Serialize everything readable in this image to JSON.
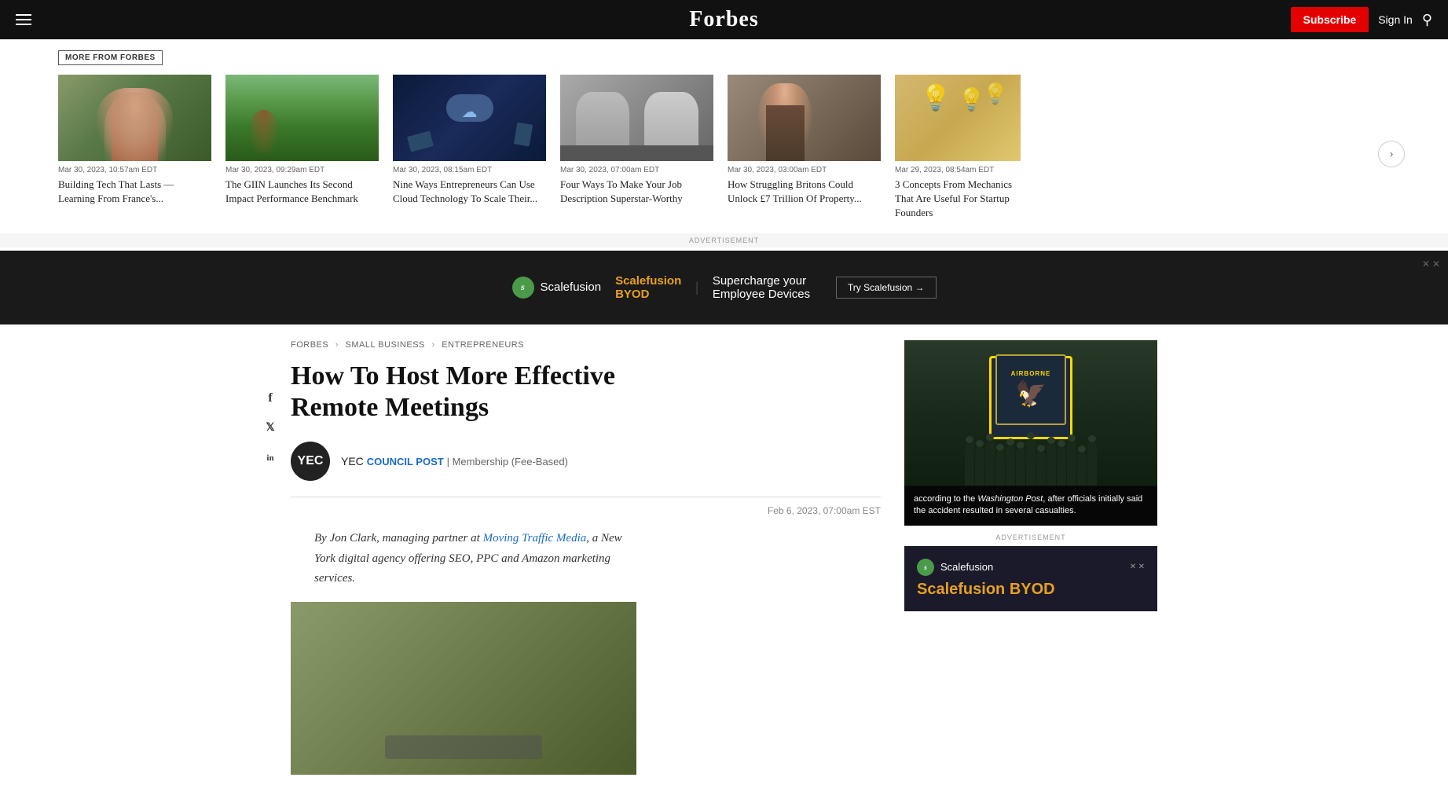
{
  "header": {
    "logo": "Forbes",
    "subscribe_label": "Subscribe",
    "sign_in_label": "Sign In"
  },
  "more_from_forbes": {
    "badge_label": "MORE FROM FORBES",
    "cards": [
      {
        "id": "card-1",
        "date": "Mar 30, 2023, 10:57am EDT",
        "title": "Building Tech That Lasts — Learning From France's...",
        "img_type": "person"
      },
      {
        "id": "card-2",
        "date": "Mar 30, 2023, 09:29am EDT",
        "title": "The GIIN Launches Its Second Impact Performance Benchmark",
        "img_type": "farm"
      },
      {
        "id": "card-3",
        "date": "Mar 30, 2023, 08:15am EDT",
        "title": "Nine Ways Entrepreneurs Can Use Cloud Technology To Scale Their...",
        "img_type": "cloud"
      },
      {
        "id": "card-4",
        "date": "Mar 30, 2023, 07:00am EDT",
        "title": "Four Ways To Make Your Job Description Superstar-Worthy",
        "img_type": "handshake"
      },
      {
        "id": "card-5",
        "date": "Mar 30, 2023, 03:00am EDT",
        "title": "How Struggling Britons Could Unlock £7 Trillion Of Property...",
        "img_type": "person2"
      },
      {
        "id": "card-6",
        "date": "Mar 29, 2023, 08:54am EDT",
        "title": "3 Concepts From Mechanics That Are Useful For Startup Founders",
        "img_type": "lightbulb"
      }
    ]
  },
  "advertisement": {
    "label": "ADVERTISEMENT",
    "brand": "Scalefusion",
    "byod": "Scalefusion BYOD",
    "tagline": "Supercharge your Employee Devices",
    "cta": "Try Scalefusion →"
  },
  "breadcrumb": {
    "items": [
      "FORBES",
      "SMALL BUSINESS",
      "ENTREPRENEURS"
    ]
  },
  "article": {
    "title": "How To Host More Effective Remote Meetings",
    "author_abbr": "YEC",
    "author_name": "YEC",
    "council_post": "COUNCIL POST",
    "membership": "Membership (Fee-Based)",
    "date": "Feb 6, 2023, 07:00am EST",
    "byline": "By Jon Clark, managing partner at Moving Traffic Media, a New York digital agency offering SEO, PPC and Amazon marketing services.",
    "byline_link_text": "Moving Traffic Media"
  },
  "sidebar": {
    "military_caption": "according to the Washington Post, after officials initially said the accident resulted in several casualties.",
    "ad_label": "ADVERTISEMENT",
    "ad_brand": "Scalefusion",
    "ad_byod": "Scalefusion BYOD",
    "airborne_label": "AIRBORNE"
  }
}
